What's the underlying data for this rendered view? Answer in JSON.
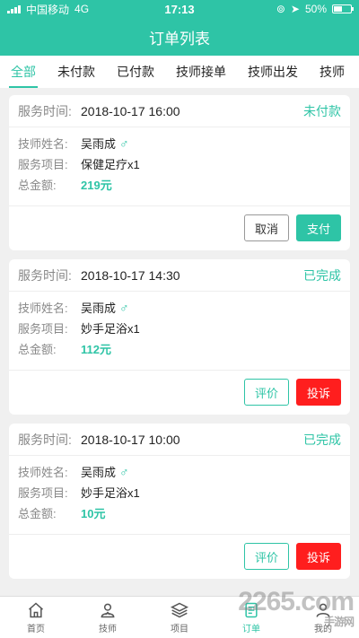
{
  "status_bar": {
    "carrier": "中国移动",
    "network": "4G",
    "time": "17:13",
    "battery": "50%",
    "battery_level": 0.5
  },
  "header": {
    "title": "订单列表"
  },
  "tabs": [
    {
      "label": "全部",
      "active": true
    },
    {
      "label": "未付款",
      "active": false
    },
    {
      "label": "已付款",
      "active": false
    },
    {
      "label": "技师接单",
      "active": false
    },
    {
      "label": "技师出发",
      "active": false
    },
    {
      "label": "技师",
      "active": false
    }
  ],
  "labels": {
    "service_time": "服务时间:",
    "tech_name": "技师姓名:",
    "service_item": "服务项目:",
    "total": "总金额:"
  },
  "orders": [
    {
      "time": "2018-10-17 16:00",
      "status": "未付款",
      "tech": "吴雨成",
      "gender": "♂",
      "item": "保健足疗x1",
      "amount": "219元",
      "buttons": [
        "取消",
        "支付"
      ]
    },
    {
      "time": "2018-10-17 14:30",
      "status": "已完成",
      "tech": "吴雨成",
      "gender": "♂",
      "item": "妙手足浴x1",
      "amount": "112元",
      "buttons": [
        "评价",
        "投诉"
      ]
    },
    {
      "time": "2018-10-17 10:00",
      "status": "已完成",
      "tech": "吴雨成",
      "gender": "♂",
      "item": "妙手足浴x1",
      "amount": "10元",
      "buttons": [
        "评价",
        "投诉"
      ]
    }
  ],
  "tabbar": [
    {
      "label": "首页",
      "icon": "home-icon",
      "active": false
    },
    {
      "label": "技师",
      "icon": "technician-icon",
      "active": false
    },
    {
      "label": "项目",
      "icon": "layers-icon",
      "active": false
    },
    {
      "label": "订单",
      "icon": "order-icon",
      "active": true
    },
    {
      "label": "我的",
      "icon": "profile-icon",
      "active": false
    }
  ],
  "watermark": {
    "brand": "2265.com",
    "sub": "手游网"
  },
  "colors": {
    "accent": "#2ec4a6",
    "danger": "#ff1e1e"
  }
}
